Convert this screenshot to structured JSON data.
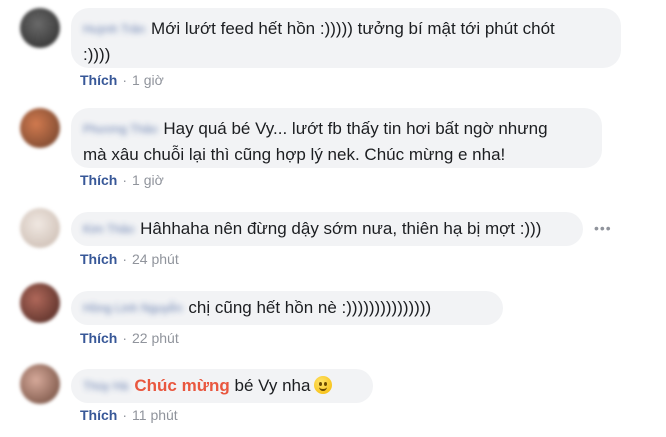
{
  "colors": {
    "link": "#385898",
    "muted": "#90949c",
    "bubble_bg": "#f2f3f5",
    "mention": "#e9573f"
  },
  "comments": [
    {
      "name": "Huỳnh Trân",
      "text_line1": "Mới lướt feed hết hồn :))))) tưởng bí mật tới phút chót",
      "text_line2": ":))))",
      "like": "Thích",
      "time": "1 giờ",
      "avatar_color": "#3d3d3d"
    },
    {
      "name": "Phương Thảo",
      "text_line1": "Hay quá bé Vy... lướt fb thấy tin hơi bất ngờ nhưng",
      "text_line2": "mà xâu chuỗi lại thì cũng hợp lý nek. Chúc mừng e nha!",
      "like": "Thích",
      "time": "1 giờ",
      "avatar_color": "#b04a2a"
    },
    {
      "name": "Kim Thảo",
      "text": "Hâhhaha nên đừng dậy sớm nưa, thiên hạ bị mợt :)))",
      "like": "Thích",
      "time": "24 phút",
      "avatar_color": "#d9cfc8",
      "more": "•••"
    },
    {
      "name": "Hồng Linh Nguyễn",
      "text": "chị cũng hết hồn nè :)))))))))))))))",
      "like": "Thích",
      "time": "22 phút",
      "avatar_color": "#7a4032"
    },
    {
      "name": "Thùy Hà",
      "mention": "Chúc mừng",
      "text": "bé Vy nha",
      "emoji": "smiling-face",
      "like": "Thích",
      "time": "11 phút",
      "avatar_color": "#a87a6b"
    }
  ],
  "separator": "·"
}
